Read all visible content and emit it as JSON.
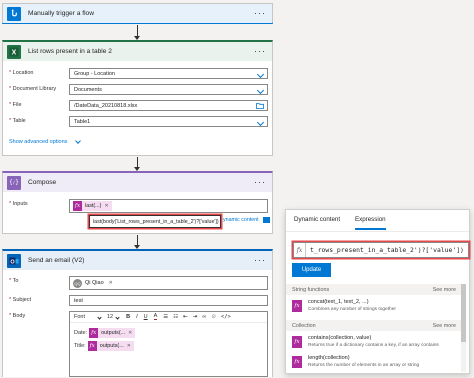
{
  "trigger": {
    "title": "Manually trigger a flow",
    "more": "···",
    "icon": "manual-trigger-icon",
    "color": "#0078d4"
  },
  "list_rows": {
    "title": "List rows present in a table 2",
    "more": "···",
    "icon": "excel-icon",
    "color": "#217346",
    "fields": [
      {
        "label": "Location",
        "value": "Group - Location"
      },
      {
        "label": "Document Library",
        "value": "Documents"
      },
      {
        "label": "File",
        "value": "/DateData_20210818.xlsx"
      },
      {
        "label": "Table",
        "value": "Table1"
      }
    ],
    "advanced": "Show advanced options"
  },
  "compose": {
    "title": "Compose",
    "more": "···",
    "icon": "compose-icon",
    "color": "#8764b8",
    "inputs_label": "Inputs",
    "token": "last(...)",
    "tooltip": "last(body('List_rows_present_in_a_table_2')?['value'])",
    "dynamic_link": "ynamic content"
  },
  "email": {
    "title": "Send an email (V2)",
    "more": "···",
    "icon": "outlook-icon",
    "color": "#0364b8",
    "to_label": "To",
    "recipient_initials": "QQ",
    "recipient": "Qi Qiao",
    "subject_label": "Subject",
    "subject_value": "test",
    "body_label": "Body",
    "font_select": "Font",
    "font_size": "12",
    "bold": "B",
    "italic": "I",
    "underline": "U",
    "body_lines": [
      {
        "label": "Date:",
        "token": "outputs(..."
      },
      {
        "label": "Title:",
        "token": "outputs(..."
      }
    ]
  },
  "expression_panel": {
    "tabs": [
      "Dynamic content",
      "Expression"
    ],
    "expression": "t_rows_present_in_a_table_2')?['value'])",
    "update": "Update",
    "sections": [
      {
        "name": "String functions",
        "more": "See more",
        "functions": [
          {
            "name": "concat(text_1, text_2, ...)",
            "desc": "Combines any number of strings together"
          }
        ]
      },
      {
        "name": "Collection",
        "more": "See more",
        "functions": [
          {
            "name": "contains(collection, value)",
            "desc": "Returns true if a dictionary contains a key, if an array contains"
          },
          {
            "name": "length(collection)",
            "desc": "Returns the number of elements in an array or string"
          }
        ]
      }
    ]
  },
  "required_mark": "*",
  "fx": "fx"
}
